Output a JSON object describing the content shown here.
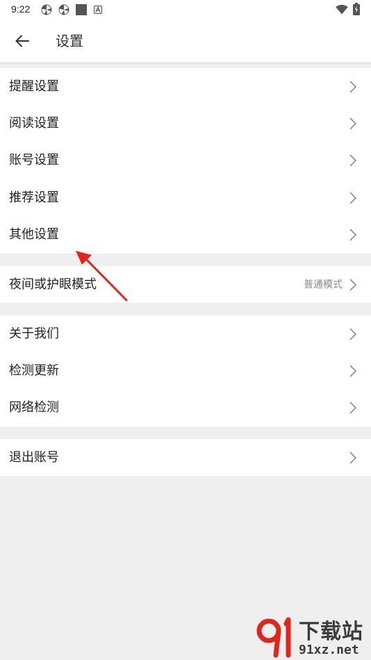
{
  "status_bar": {
    "time": "9:22",
    "icons": [
      "pinwheel-icon",
      "pinwheel-icon",
      "square-icon",
      "a-badge-icon",
      "wifi-icon",
      "battery-icon"
    ]
  },
  "toolbar": {
    "back_icon": "arrow-left-icon",
    "title": "设置"
  },
  "groups": [
    {
      "items": [
        {
          "label": "提醒设置"
        },
        {
          "label": "阅读设置"
        },
        {
          "label": "账号设置"
        },
        {
          "label": "推荐设置"
        },
        {
          "label": "其他设置"
        }
      ]
    },
    {
      "items": [
        {
          "label": "夜间或护眼模式",
          "value": "普通模式"
        }
      ]
    },
    {
      "items": [
        {
          "label": "关于我们"
        },
        {
          "label": "检测更新"
        },
        {
          "label": "网络检测"
        }
      ]
    },
    {
      "items": [
        {
          "label": "退出账号"
        }
      ]
    }
  ],
  "annotation": {
    "color": "#e0251b",
    "target": "其他设置"
  },
  "watermark": {
    "title": "下载站",
    "domain": "91xz.net",
    "logo_icon": "91-logo-icon"
  },
  "colors": {
    "background": "#efefef",
    "surface": "#ffffff",
    "text": "#222222",
    "secondary_text": "#8a8a8a",
    "chevron": "#8c8c8c"
  }
}
